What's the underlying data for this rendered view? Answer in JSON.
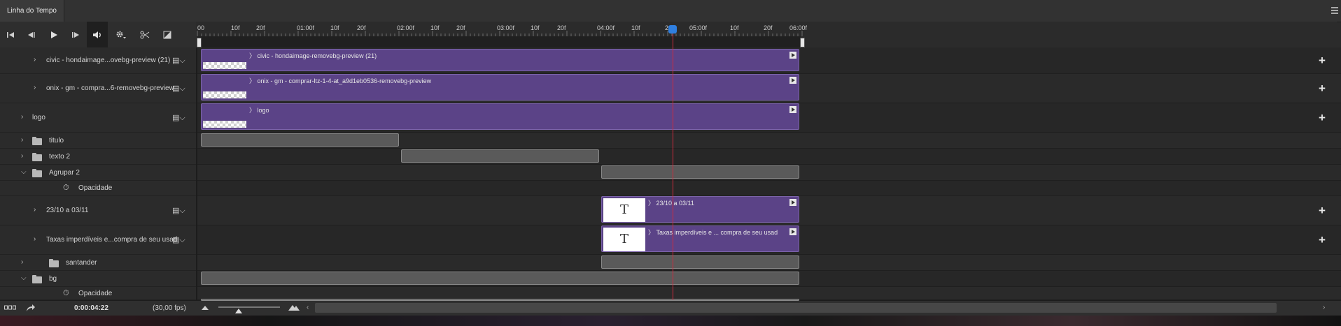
{
  "panel": {
    "title": "Linha do Tempo"
  },
  "controls": [
    {
      "name": "first-frame-button",
      "glyph": "⏮"
    },
    {
      "name": "previous-frame-button",
      "glyph": "◀"
    },
    {
      "name": "play-button",
      "glyph": "▶"
    },
    {
      "name": "next-frame-button",
      "glyph": "▶|"
    },
    {
      "name": "audio-button",
      "glyph": "🔊"
    },
    {
      "name": "settings-button",
      "glyph": "⚙"
    },
    {
      "name": "split-button",
      "glyph": "✂"
    },
    {
      "name": "transition-button",
      "glyph": "◪"
    }
  ],
  "ruler": {
    "labels": [
      "00",
      "10f",
      "20f",
      "01:00f",
      "10f",
      "20f",
      "02:00f",
      "10f",
      "20f",
      "03:00f",
      "10f",
      "20f",
      "04:00f",
      "10f",
      "20f",
      "05:00f",
      "10f",
      "20f",
      "06:00f"
    ]
  },
  "layers": [
    {
      "label": "civic - hondaimage...ovebg-preview (21)",
      "type": "video",
      "indent": 1
    },
    {
      "label": "onix - gm - compra...6-removebg-preview",
      "type": "video",
      "indent": 1
    },
    {
      "label": "logo",
      "type": "video",
      "indent": 0
    },
    {
      "label": "titulo",
      "type": "group",
      "indent": 0
    },
    {
      "label": "texto 2",
      "type": "group",
      "indent": 0
    },
    {
      "label": "Agrupar 2",
      "type": "group-open",
      "indent": 0
    },
    {
      "label": "Opacidade",
      "type": "property",
      "indent": 2
    },
    {
      "label": "23/10 a 03/11",
      "type": "video",
      "indent": 1
    },
    {
      "label": "Taxas imperdíveis e...compra de seu usad",
      "type": "video",
      "indent": 1
    },
    {
      "label": "santander",
      "type": "group",
      "indent": 1
    },
    {
      "label": "bg",
      "type": "group-open",
      "indent": 0
    },
    {
      "label": "Opacidade",
      "type": "property",
      "indent": 2
    }
  ],
  "clips": [
    {
      "label": "civic - hondaimage-removebg-preview (21)",
      "kind": "image"
    },
    {
      "label": "onix - gm - comprar-ltz-1-4-at_a9d1eb0536-removebg-preview",
      "kind": "image"
    },
    {
      "label": "logo",
      "kind": "image"
    },
    {
      "label": "23/10 a 03/11",
      "kind": "text",
      "thumb": "T"
    },
    {
      "label": "Taxas imperdíveis e ... compra de seu usad",
      "kind": "text",
      "thumb": "T"
    }
  ],
  "status": {
    "timecode": "0:00:04:22",
    "fps": "(30,00 fps)"
  },
  "colors": {
    "clip": "#5b4387",
    "playhead": "#d12a3e",
    "handle": "#2f7fe0"
  }
}
